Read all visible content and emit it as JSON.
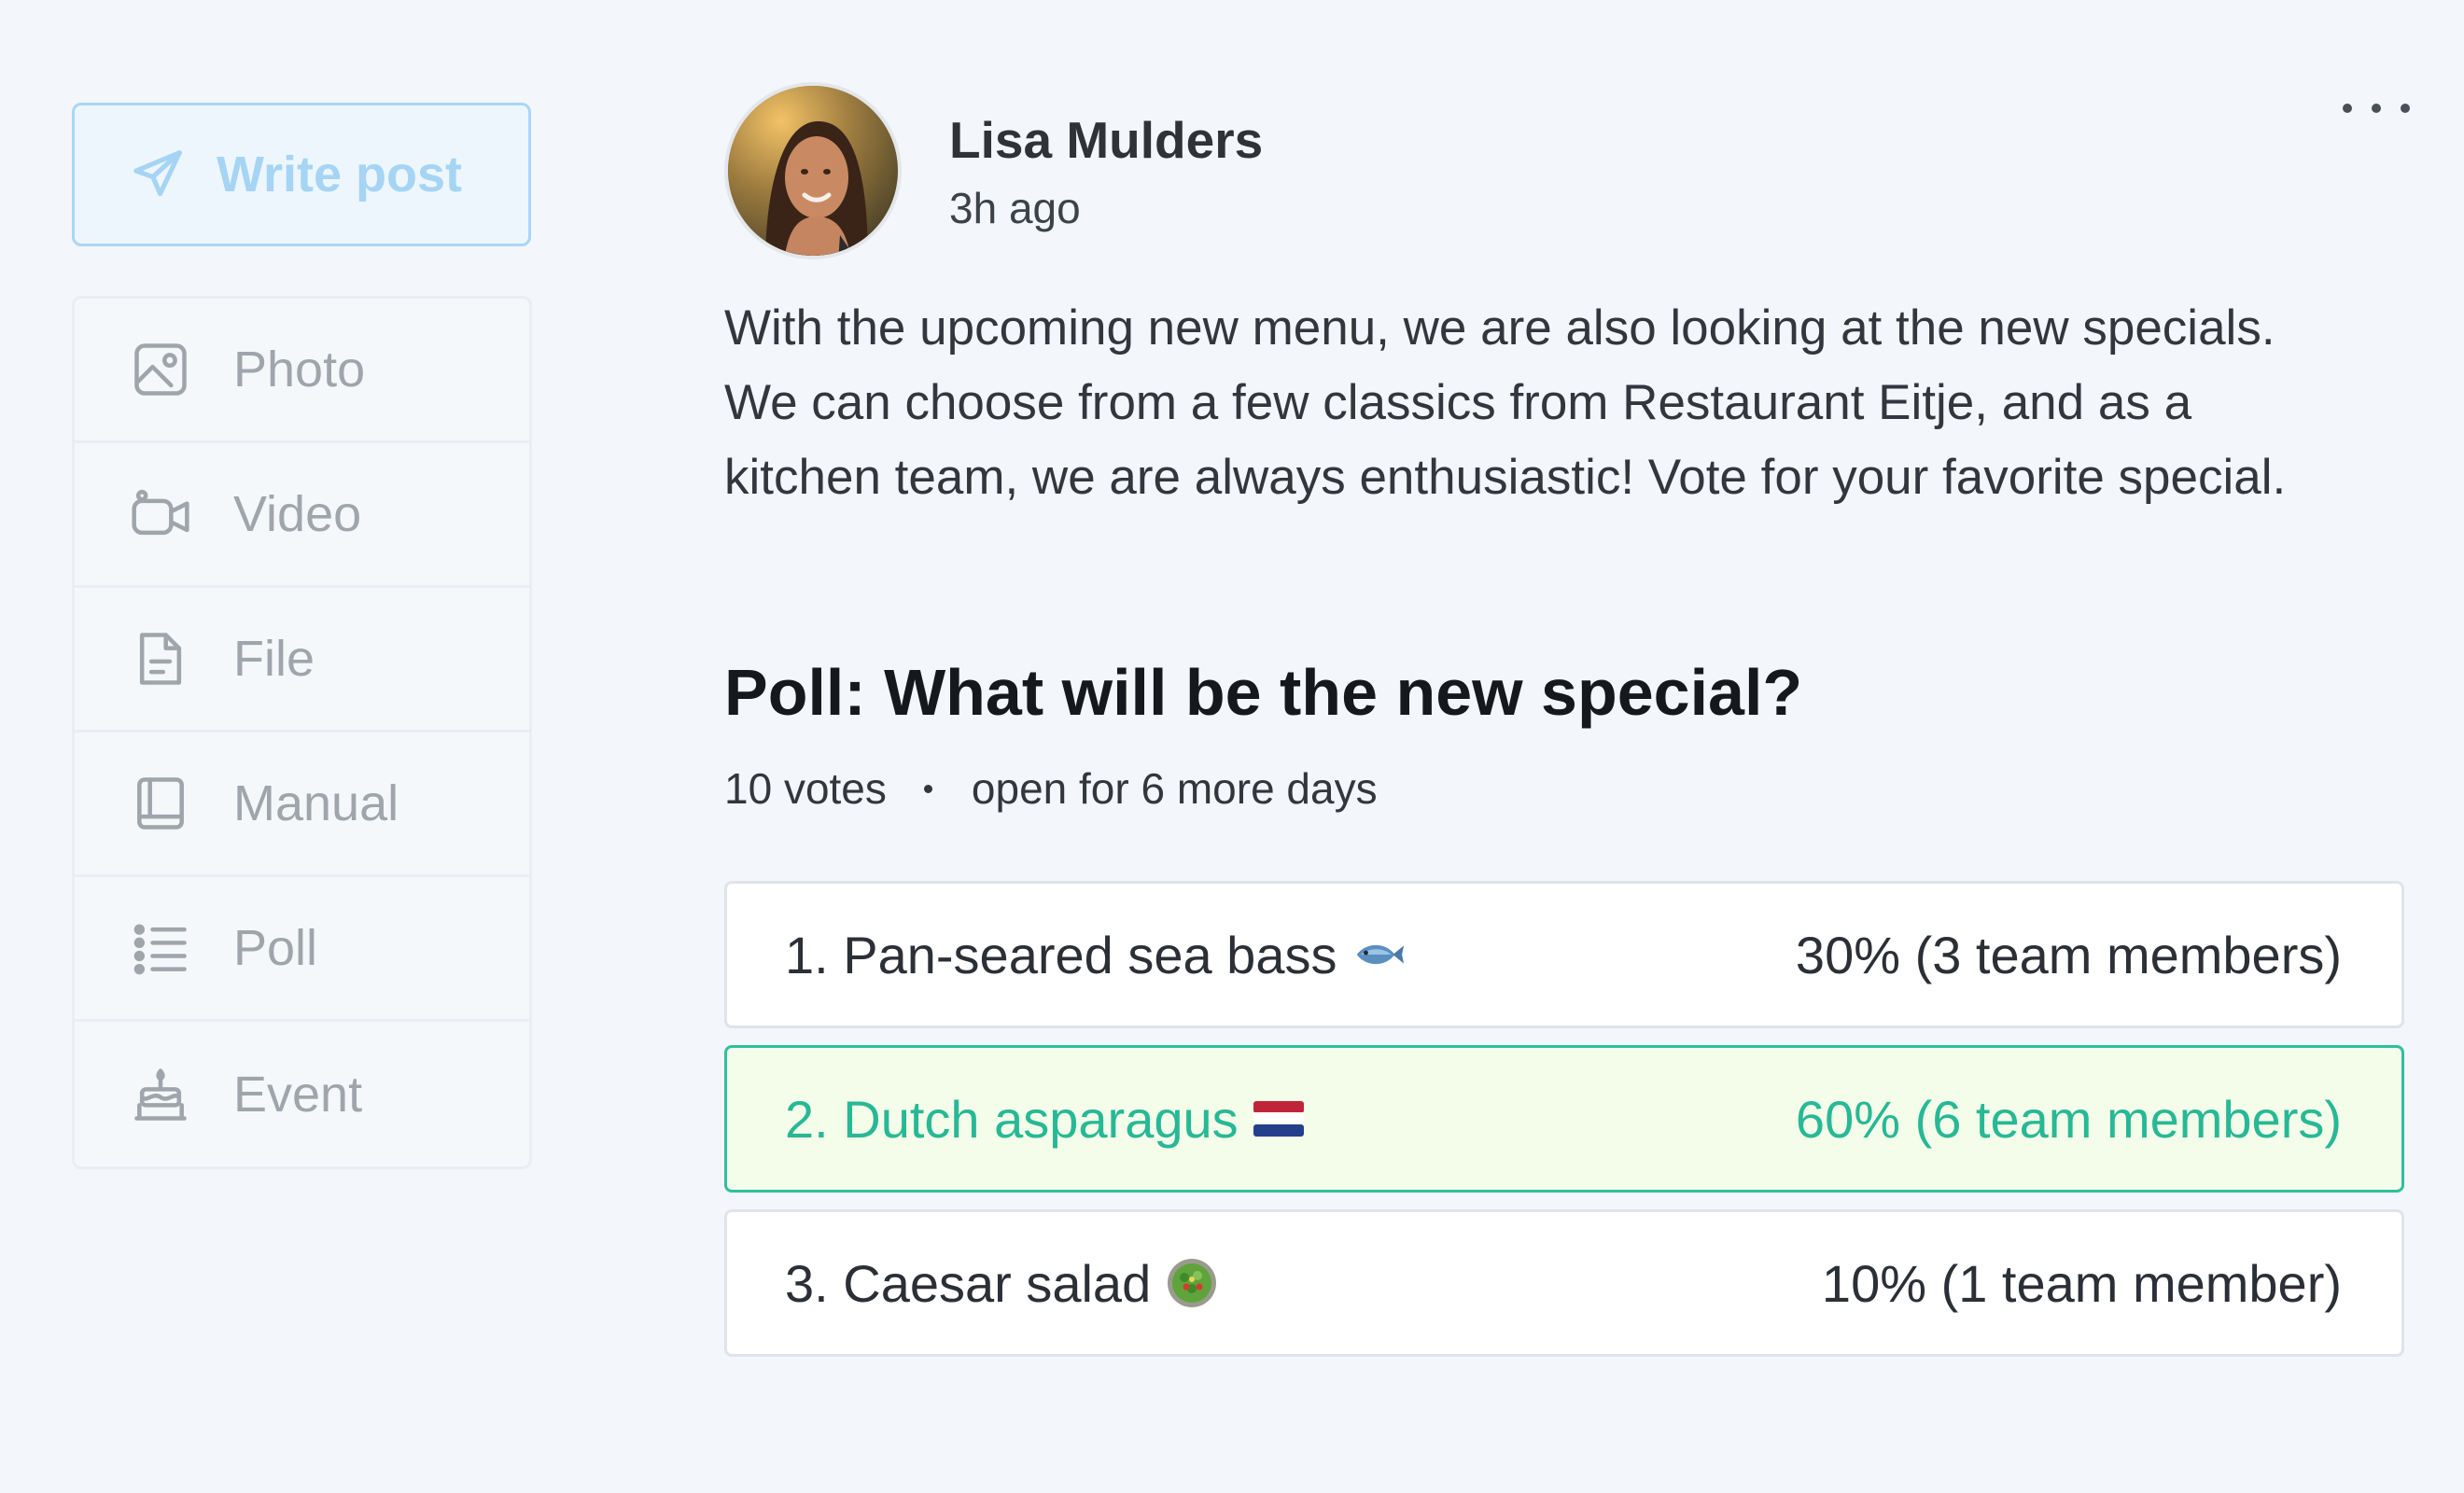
{
  "sidebar": {
    "write_post_label": "Write post",
    "items": [
      {
        "label": "Photo",
        "icon": "photo-icon"
      },
      {
        "label": "Video",
        "icon": "video-icon"
      },
      {
        "label": "File",
        "icon": "file-icon"
      },
      {
        "label": "Manual",
        "icon": "book-icon"
      },
      {
        "label": "Poll",
        "icon": "list-icon"
      },
      {
        "label": "Event",
        "icon": "cake-icon"
      }
    ]
  },
  "post": {
    "author": "Lisa Mulders",
    "timestamp": "3h ago",
    "body": "With the upcoming new menu, we are also looking at the new specials. We can choose from a few classics from Restaurant Eitje, and as a kitchen team, we are always enthusiastic! Vote for your favorite special."
  },
  "poll": {
    "title": "Poll: What will be the new special?",
    "votes": "10 votes",
    "status": "open for 6 more days",
    "options": [
      {
        "label": "1. Pan-seared sea bass",
        "emoji": "fish-icon",
        "result": "30% (3 team members)",
        "percent": 30,
        "selected": false
      },
      {
        "label": "2. Dutch asparagus",
        "emoji": "dutch-flag-icon",
        "result": "60% (6 team members)",
        "percent": 60,
        "selected": true
      },
      {
        "label": "3. Caesar salad",
        "emoji": "salad-icon",
        "result": "10% (1 team member)",
        "percent": 10,
        "selected": false
      }
    ]
  },
  "colors": {
    "accent_blue": "#a6d4f4",
    "selected_green": "#28b896",
    "selected_bg": "#f3fde9",
    "background": "#f3f6fa"
  }
}
